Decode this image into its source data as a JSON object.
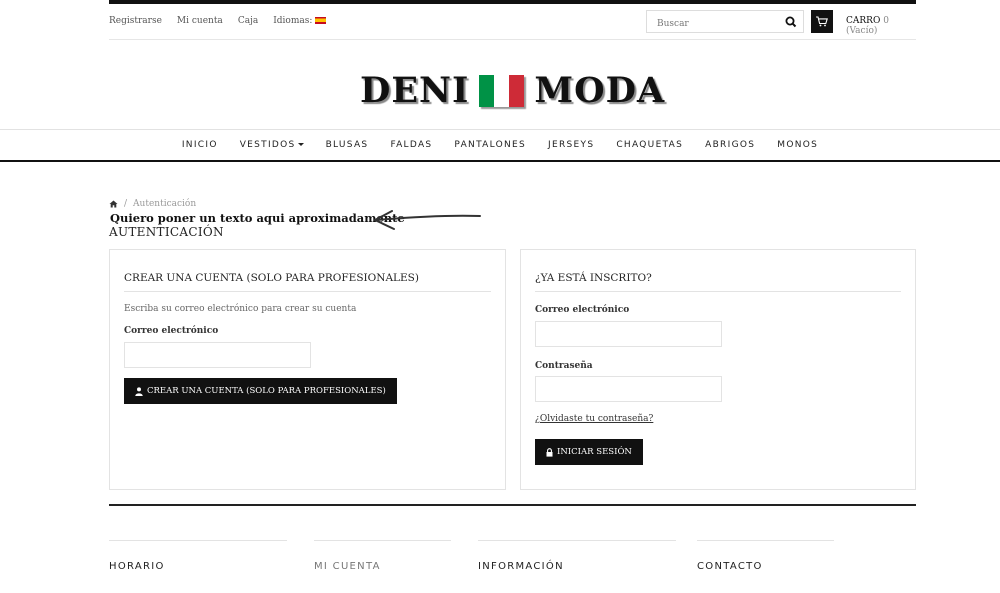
{
  "topbar": {
    "links": [
      "Registrarse",
      "Mi cuenta",
      "Caja"
    ],
    "languages_label": "Idiomas:",
    "search_placeholder": "Buscar",
    "cart_label": "CARRO",
    "cart_status": "0 (Vacío)"
  },
  "logo": {
    "left": "DENI",
    "right": "MODA",
    "flag_colors": [
      "#009246",
      "#ffffff",
      "#ce2b37"
    ]
  },
  "nav": [
    "INICIO",
    "VESTIDOS",
    "BLUSAS",
    "FALDAS",
    "PANTALONES",
    "JERSEYS",
    "CHAQUETAS",
    "ABRIGOS",
    "MONOS"
  ],
  "breadcrumb": {
    "home_icon": "home-icon",
    "separator": "/",
    "current": "Autenticación"
  },
  "annotation": "Quiero poner un texto aqui aproximadamente",
  "page_title": "AUTENTICACIÓN",
  "create_account": {
    "title": "CREAR UNA CUENTA (SOLO PARA PROFESIONALES)",
    "description": "Escriba su correo electrónico para crear su cuenta",
    "email_label": "Correo electrónico",
    "email_value": "",
    "button": "CREAR UNA CUENTA (SOLO PARA PROFESIONALES)"
  },
  "login": {
    "title": "¿YA ESTÁ INSCRITO?",
    "email_label": "Correo electrónico",
    "email_value": "",
    "password_label": "Contraseña",
    "password_value": "",
    "forgot": "¿Olvidaste tu contraseña?",
    "button": "INICIAR SESIÓN"
  },
  "footer": [
    "HORARIO",
    "MI CUENTA",
    "INFORMACIÓN",
    "CONTACTO"
  ],
  "colors": {
    "dark": "#111111",
    "border": "#e3e3e3",
    "muted": "#999999"
  }
}
